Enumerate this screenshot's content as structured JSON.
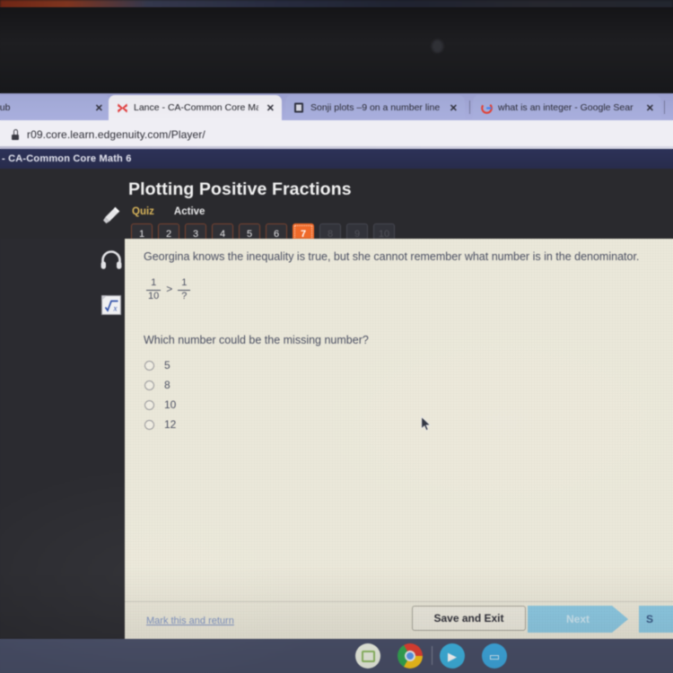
{
  "browser": {
    "tabs": [
      {
        "title": "elligent Hub",
        "favicon": "",
        "close_label": "✕",
        "active": false
      },
      {
        "title": "Lance - CA-Common Core Math",
        "favicon": "X",
        "close_label": "✕",
        "active": true
      },
      {
        "title": "Sonji plots –9 on a number line",
        "favicon": "■",
        "close_label": "✕",
        "active": false
      },
      {
        "title": "what is an integer - Google Sear",
        "favicon": "G",
        "close_label": "✕",
        "active": false
      }
    ],
    "omnibox": {
      "url": "r09.core.learn.edgenuity.com/Player/",
      "lock_icon": "lock-icon"
    }
  },
  "player": {
    "breadcrumb": "- CA-Common Core Math 6",
    "lesson_title": "Plotting Positive Fractions",
    "activity_type": "Quiz",
    "activity_status": "Active",
    "question_nav": {
      "items": [
        {
          "label": "1",
          "state": "available"
        },
        {
          "label": "2",
          "state": "available"
        },
        {
          "label": "3",
          "state": "available"
        },
        {
          "label": "4",
          "state": "available"
        },
        {
          "label": "5",
          "state": "available"
        },
        {
          "label": "6",
          "state": "available"
        },
        {
          "label": "7",
          "state": "current"
        },
        {
          "label": "8",
          "state": "dim"
        },
        {
          "label": "9",
          "state": "dim"
        },
        {
          "label": "10",
          "state": "dim"
        }
      ]
    },
    "tools": [
      {
        "name": "highlighter-icon",
        "label": "Highlighter"
      },
      {
        "name": "headphones-icon",
        "label": "Text to speech"
      },
      {
        "name": "calculator-icon",
        "label": "Math tools"
      }
    ]
  },
  "question": {
    "stem": "Georgina knows the inequality is true, but she cannot remember what number is in the denominator.",
    "inequality": {
      "left": {
        "numerator": "1",
        "denominator": "10"
      },
      "operator": ">",
      "right": {
        "numerator": "1",
        "denominator": "?"
      }
    },
    "prompt": "Which number could be the missing number?",
    "choices": [
      {
        "label": "5",
        "selected": false
      },
      {
        "label": "8",
        "selected": false
      },
      {
        "label": "10",
        "selected": false
      },
      {
        "label": "12",
        "selected": false
      }
    ]
  },
  "footer": {
    "mark_link": "Mark this and return",
    "save_exit": "Save and Exit",
    "next": "Next",
    "submit": "S"
  },
  "shelf": {
    "icons": [
      {
        "name": "launcher-icon",
        "label": "Launcher"
      },
      {
        "name": "chrome-icon",
        "label": "Chrome"
      },
      {
        "name": "meet-icon",
        "label": "Meet",
        "glyph": "▶"
      },
      {
        "name": "files-icon",
        "label": "Files",
        "glyph": "▭"
      }
    ]
  },
  "colors": {
    "accent_orange": "#ef6a2a",
    "quiz_gold": "#d8b45a",
    "card_cream": "#ece9da",
    "button_blue": "#8fcbe4",
    "breadcrumb_navy": "#2d3258",
    "text_slate": "#4a4f63"
  }
}
